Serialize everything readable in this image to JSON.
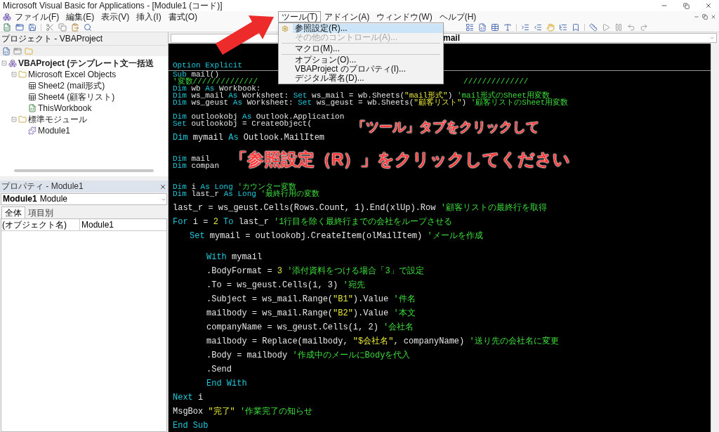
{
  "window": {
    "title": "Microsoft Visual Basic for Applications - [Module1 (コード)]"
  },
  "menus": [
    {
      "kind": "menu",
      "label": "ファイル(F)",
      "selected": false
    },
    {
      "kind": "menu",
      "label": "編集(E)",
      "selected": false
    },
    {
      "kind": "menu",
      "label": "表示(V)",
      "selected": false
    },
    {
      "kind": "menu",
      "label": "挿入(I)",
      "selected": false
    },
    {
      "kind": "menu",
      "label": "書式(O)",
      "selected": false
    },
    {
      "kind": "covered"
    },
    {
      "kind": "menu",
      "label": "ツール(T)",
      "selected": true
    },
    {
      "kind": "menu",
      "label": "アドイン(A)",
      "selected": false
    },
    {
      "kind": "menu",
      "label": "ウィンドウ(W)",
      "selected": false
    },
    {
      "kind": "menu",
      "label": "ヘルプ(H)",
      "selected": false
    }
  ],
  "tools_menu": [
    {
      "kind": "item",
      "label": "参照設定(R)...",
      "selected": true,
      "disabled": false
    },
    {
      "kind": "item",
      "label": "その他のコントロール(A)...",
      "selected": false,
      "disabled": true
    },
    {
      "kind": "separator"
    },
    {
      "kind": "item",
      "label": "マクロ(M)...",
      "selected": false,
      "disabled": false
    },
    {
      "kind": "separator"
    },
    {
      "kind": "item",
      "label": "オプション(O)...",
      "selected": false,
      "disabled": false
    },
    {
      "kind": "item",
      "label": "VBAProject のプロパティ(I)...",
      "selected": false,
      "disabled": false
    },
    {
      "kind": "item",
      "label": "デジタル署名(D)...",
      "selected": false,
      "disabled": false
    }
  ],
  "project": {
    "title": "プロジェクト - VBAProject",
    "tree": [
      {
        "kind": "project",
        "label": "VBAProject (テンプレート文一括送",
        "expanded": true,
        "children": [
          {
            "kind": "folder",
            "label": "Microsoft Excel Objects",
            "expanded": true,
            "children": [
              {
                "kind": "sheet",
                "label": "Sheet2 (mail形式)"
              },
              {
                "kind": "sheet",
                "label": "Sheet4 (顧客リスト)"
              },
              {
                "kind": "workbook",
                "label": "ThisWorkbook"
              }
            ]
          },
          {
            "kind": "folder",
            "label": "標準モジュール",
            "expanded": true,
            "children": [
              {
                "kind": "module",
                "label": "Module1"
              }
            ]
          }
        ]
      }
    ]
  },
  "properties": {
    "title": "プロパティ - Module1",
    "object": {
      "name": "Module1",
      "type": "Module"
    },
    "tabs": [
      {
        "label": "全体",
        "selected": true
      },
      {
        "label": "項目別",
        "selected": false
      }
    ],
    "rows": [
      {
        "name": "(オブジェクト名)",
        "value": "Module1"
      }
    ]
  },
  "code_window": {
    "procedure": "mail",
    "lines": [
      {
        "kind": "code",
        "segments": [
          {
            "kind": "keyword",
            "text": "Option Explicit"
          }
        ]
      },
      {
        "kind": "separator"
      },
      {
        "kind": "code",
        "segments": [
          {
            "kind": "keyword",
            "text": "Sub "
          },
          {
            "kind": "text",
            "text": "mail()"
          }
        ]
      },
      {
        "kind": "code",
        "segments": [
          {
            "kind": "comment",
            "text": "'変数//////////////"
          },
          {
            "kind": "covered"
          },
          {
            "kind": "comment",
            "text": "//////////////"
          }
        ]
      },
      {
        "kind": "code",
        "segments": [
          {
            "kind": "keyword",
            "text": "Dim "
          },
          {
            "kind": "text",
            "text": "wb "
          },
          {
            "kind": "keyword",
            "text": "As "
          },
          {
            "kind": "text",
            "text": "Workbook:"
          }
        ]
      },
      {
        "kind": "code",
        "segments": [
          {
            "kind": "keyword",
            "text": "Dim "
          },
          {
            "kind": "text",
            "text": "ws_mail "
          },
          {
            "kind": "keyword",
            "text": "As "
          },
          {
            "kind": "text",
            "text": "Worksheet: "
          },
          {
            "kind": "keyword",
            "text": "Set "
          },
          {
            "kind": "text",
            "text": "ws_mail = wb.Sheets("
          },
          {
            "kind": "string",
            "text": "\"mail形式\""
          },
          {
            "kind": "text",
            "text": ") "
          },
          {
            "kind": "comment",
            "text": "'mail形式のSheet用変数"
          }
        ]
      },
      {
        "kind": "code",
        "segments": [
          {
            "kind": "keyword",
            "text": "Dim "
          },
          {
            "kind": "text",
            "text": "ws_geust "
          },
          {
            "kind": "keyword",
            "text": "As "
          },
          {
            "kind": "text",
            "text": "Worksheet: "
          },
          {
            "kind": "keyword",
            "text": "Set "
          },
          {
            "kind": "text",
            "text": "ws_geust = wb.Sheets("
          },
          {
            "kind": "string",
            "text": "\"顧客リスト\""
          },
          {
            "kind": "text",
            "text": ") "
          },
          {
            "kind": "comment",
            "text": "'顧客リストのSheet用変数"
          }
        ]
      },
      {
        "kind": "blank"
      },
      {
        "kind": "code",
        "segments": [
          {
            "kind": "keyword",
            "text": "Dim "
          },
          {
            "kind": "text",
            "text": "outlookobj "
          },
          {
            "kind": "keyword",
            "text": "As "
          },
          {
            "kind": "text",
            "text": "Outlook.Application"
          }
        ]
      },
      {
        "kind": "code",
        "segments": [
          {
            "kind": "keyword",
            "text": "Set "
          },
          {
            "kind": "text",
            "text": "outlookobj = CreateObject("
          },
          {
            "kind": "covered"
          }
        ]
      },
      {
        "kind": "blank"
      },
      {
        "kind": "code",
        "segments": [
          {
            "kind": "keyword",
            "text": "Dim "
          },
          {
            "kind": "text",
            "text": "mymail "
          },
          {
            "kind": "keyword",
            "text": "As "
          },
          {
            "kind": "text",
            "text": "Outlook.MailItem"
          }
        ]
      },
      {
        "kind": "blank"
      },
      {
        "kind": "blank"
      },
      {
        "kind": "code",
        "segments": [
          {
            "kind": "keyword",
            "text": "Dim "
          },
          {
            "kind": "text",
            "text": "mail"
          },
          {
            "kind": "covered"
          }
        ]
      },
      {
        "kind": "code",
        "segments": [
          {
            "kind": "keyword",
            "text": "Dim "
          },
          {
            "kind": "text",
            "text": "compan"
          },
          {
            "kind": "covered"
          }
        ]
      },
      {
        "kind": "blank"
      },
      {
        "kind": "blank"
      },
      {
        "kind": "code",
        "segments": [
          {
            "kind": "keyword",
            "text": "Dim "
          },
          {
            "kind": "text",
            "text": "i "
          },
          {
            "kind": "keyword",
            "text": "As Long "
          },
          {
            "kind": "comment",
            "text": "'カウンター変数"
          }
        ]
      },
      {
        "kind": "code",
        "segments": [
          {
            "kind": "keyword",
            "text": "Dim "
          },
          {
            "kind": "text",
            "text": "last_r "
          },
          {
            "kind": "keyword",
            "text": "As Long "
          },
          {
            "kind": "comment",
            "text": "'最終行用の変数"
          }
        ]
      },
      {
        "kind": "blank"
      },
      {
        "kind": "code",
        "segments": [
          {
            "kind": "text",
            "text": "last_r = ws_geust.Cells(Rows.Count, 1).End(xlUp).Row "
          },
          {
            "kind": "comment",
            "text": "'顧客リストの最終行を取得"
          }
        ]
      },
      {
        "kind": "blank"
      },
      {
        "kind": "code",
        "segments": [
          {
            "kind": "keyword",
            "text": "For "
          },
          {
            "kind": "text",
            "text": "i = "
          },
          {
            "kind": "number",
            "text": "2 "
          },
          {
            "kind": "keyword",
            "text": "To "
          },
          {
            "kind": "text",
            "text": "last_r "
          },
          {
            "kind": "comment",
            "text": "'1行目を除く最終行までの会社をループさせる"
          }
        ],
        "children": [
          {
            "kind": "blank"
          },
          {
            "kind": "code",
            "segments": [
              {
                "kind": "keyword",
                "text": "Set "
              },
              {
                "kind": "text",
                "text": "mymail = outlookobj.CreateItem(olMailItem) "
              },
              {
                "kind": "comment",
                "text": "'メールを作成"
              }
            ],
            "children": [
              {
                "kind": "blank"
              },
              {
                "kind": "blank"
              },
              {
                "kind": "code",
                "segments": [
                  {
                    "kind": "keyword",
                    "text": "With "
                  },
                  {
                    "kind": "text",
                    "text": "mymail"
                  }
                ]
              },
              {
                "kind": "blank"
              },
              {
                "kind": "code",
                "segments": [
                  {
                    "kind": "text",
                    "text": ".BodyFormat = "
                  },
                  {
                    "kind": "number",
                    "text": "3 "
                  },
                  {
                    "kind": "comment",
                    "text": "'添付資料をつける場合「3」で設定"
                  }
                ]
              },
              {
                "kind": "blank"
              },
              {
                "kind": "code",
                "segments": [
                  {
                    "kind": "text",
                    "text": ".To = ws_geust.Cells(i, 3) "
                  },
                  {
                    "kind": "comment",
                    "text": "'宛先"
                  }
                ]
              },
              {
                "kind": "blank"
              },
              {
                "kind": "code",
                "segments": [
                  {
                    "kind": "text",
                    "text": ".Subject = ws_mail.Range("
                  },
                  {
                    "kind": "string",
                    "text": "\"B1\""
                  },
                  {
                    "kind": "text",
                    "text": ").Value "
                  },
                  {
                    "kind": "comment",
                    "text": "'件名"
                  }
                ]
              },
              {
                "kind": "blank"
              },
              {
                "kind": "code",
                "segments": [
                  {
                    "kind": "text",
                    "text": "mailbody = ws_mail.Range("
                  },
                  {
                    "kind": "string",
                    "text": "\"B2\""
                  },
                  {
                    "kind": "text",
                    "text": ").Value "
                  },
                  {
                    "kind": "comment",
                    "text": "'本文"
                  }
                ]
              },
              {
                "kind": "blank"
              },
              {
                "kind": "code",
                "segments": [
                  {
                    "kind": "text",
                    "text": "companyName = ws_geust.Cells(i, 2) "
                  },
                  {
                    "kind": "comment",
                    "text": "'会社名"
                  }
                ]
              },
              {
                "kind": "blank"
              },
              {
                "kind": "code",
                "segments": [
                  {
                    "kind": "text",
                    "text": "mailbody = Replace(mailbody, "
                  },
                  {
                    "kind": "string",
                    "text": "\"$会社名\""
                  },
                  {
                    "kind": "text",
                    "text": ", companyName) "
                  },
                  {
                    "kind": "comment",
                    "text": "'送り先の会社名に変更"
                  }
                ]
              },
              {
                "kind": "blank"
              },
              {
                "kind": "code",
                "segments": [
                  {
                    "kind": "text",
                    "text": ".Body = mailbody "
                  },
                  {
                    "kind": "comment",
                    "text": "'作成中のメールにBodyを代入"
                  }
                ]
              },
              {
                "kind": "blank"
              },
              {
                "kind": "code",
                "segments": [
                  {
                    "kind": "text",
                    "text": ".Send"
                  }
                ]
              },
              {
                "kind": "blank"
              },
              {
                "kind": "code",
                "segments": [
                  {
                    "kind": "keyword",
                    "text": "End With"
                  }
                ]
              }
            ]
          }
        ]
      },
      {
        "kind": "blank"
      },
      {
        "kind": "code",
        "segments": [
          {
            "kind": "keyword",
            "text": "Next "
          },
          {
            "kind": "text",
            "text": "i"
          }
        ]
      },
      {
        "kind": "blank"
      },
      {
        "kind": "code",
        "segments": [
          {
            "kind": "text",
            "text": "MsgBox "
          },
          {
            "kind": "string",
            "text": "\"完了\" "
          },
          {
            "kind": "comment",
            "text": "'作業完了の知らせ"
          }
        ]
      },
      {
        "kind": "blank"
      },
      {
        "kind": "code",
        "segments": [
          {
            "kind": "keyword",
            "text": "End Sub"
          }
        ]
      }
    ]
  },
  "annotations": [
    "「ツール」タブをクリックして",
    "「参照設定（R）」をクリックしてください"
  ]
}
